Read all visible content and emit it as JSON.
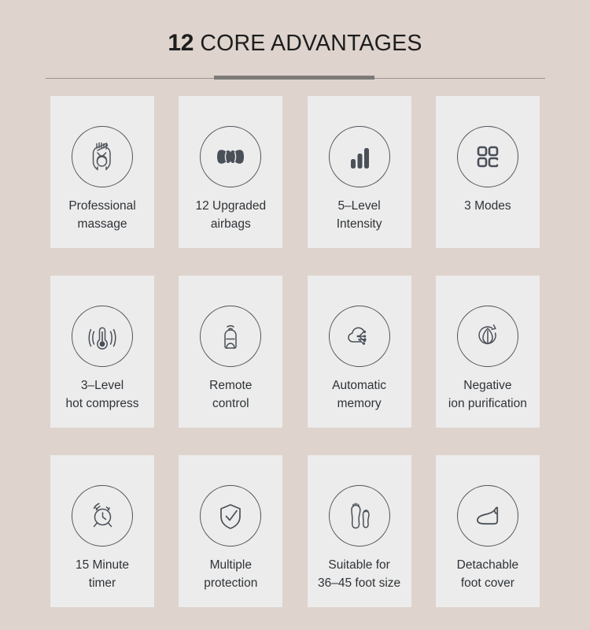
{
  "header": {
    "title_number": "12",
    "title_rest": " CORE ADVANTAGES",
    "divider_color": "#7c7a78"
  },
  "theme": {
    "background": "#ded3cd",
    "card_background": "#ececec",
    "icon_stroke": "#50565c",
    "text_color": "#2f3337",
    "title_color": "#1d1d1d"
  },
  "cards": [
    {
      "icon": "massage-hands-icon",
      "line1": "Professional",
      "line2": "massage"
    },
    {
      "icon": "airbags-icon",
      "line1": "12 Upgraded",
      "line2": "airbags"
    },
    {
      "icon": "bar-levels-icon",
      "line1": "5–Level",
      "line2": "Intensity"
    },
    {
      "icon": "grid-modes-icon",
      "line1": "3 Modes",
      "line2": ""
    },
    {
      "icon": "thermometer-heat-icon",
      "line1": "3–Level",
      "line2": "hot compress"
    },
    {
      "icon": "remote-control-icon",
      "line1": "Remote",
      "line2": "control"
    },
    {
      "icon": "cloud-memory-icon",
      "line1": "Automatic",
      "line2": "memory"
    },
    {
      "icon": "leaf-ion-icon",
      "line1": "Negative",
      "line2": "ion purification"
    },
    {
      "icon": "alarm-clock-icon",
      "line1": "15 Minute",
      "line2": "timer"
    },
    {
      "icon": "shield-check-icon",
      "line1": "Multiple",
      "line2": "protection"
    },
    {
      "icon": "footprints-icon",
      "line1": "Suitable for",
      "line2": "36–45 foot size"
    },
    {
      "icon": "foot-cover-icon",
      "line1": "Detachable",
      "line2": "foot cover"
    }
  ]
}
